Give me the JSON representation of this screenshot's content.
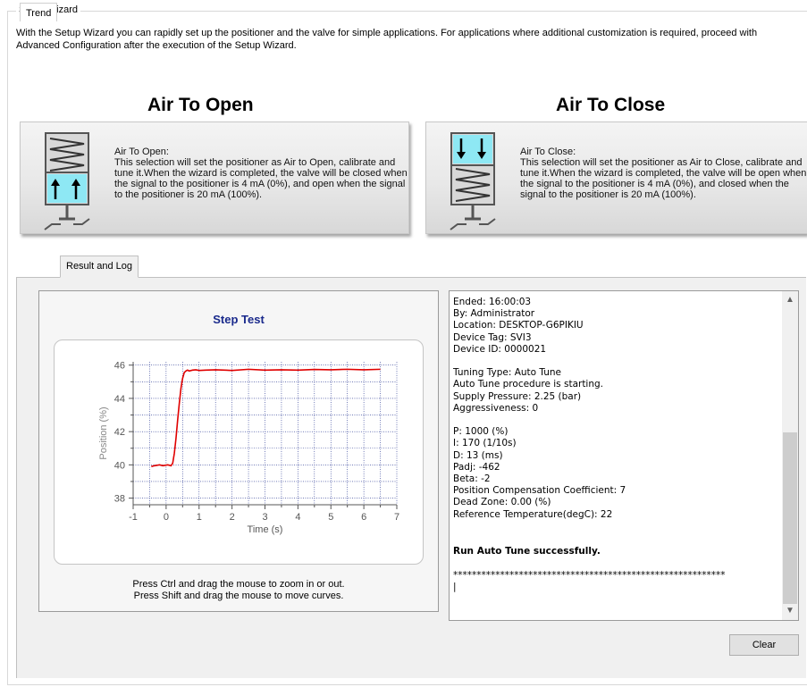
{
  "group_title": "Setup Wizard",
  "intro": "With the Setup Wizard you can rapidly set up the positioner and the valve for simple applications. For applications where additional customization is required, proceed with Advanced Configuration after the execution of the Setup Wizard.",
  "modes": {
    "open": {
      "title": "Air To Open",
      "heading": "Air To Open:",
      "text": "This selection will set the positioner as Air to Open, calibrate and tune it.When the wizard is completed, the valve will be closed when the signal to the positioner is 4 mA (0%), and open when the signal to the positioner is 20 mA (100%)."
    },
    "close": {
      "title": "Air To Close",
      "heading": "Air To Close:",
      "text": "This selection will set the positioner as Air to Close, calibrate and tune it.When the wizard is completed, the valve will be open when the signal to the positioner is 4 mA (0%), and closed when the signal to the positioner is 20 mA (100%)."
    }
  },
  "tabs": [
    "Trend",
    "Result and Log"
  ],
  "active_tab": "Result and Log",
  "chart_hint": [
    "Press Ctrl and drag the mouse to zoom in or out.",
    "Press Shift and drag the mouse to move curves."
  ],
  "chart_data": {
    "type": "line",
    "title": "Step Test",
    "xlabel": "Time (s)",
    "ylabel": "Position (%)",
    "xlim": [
      -1,
      7
    ],
    "ylim": [
      37.6,
      46.2
    ],
    "xticks": [
      -1,
      0,
      1,
      2,
      3,
      4,
      5,
      6,
      7
    ],
    "yticks": [
      38,
      40,
      42,
      44,
      46
    ],
    "grid": true,
    "line_color": "#e00000",
    "series": [
      {
        "x": [
          -0.45,
          -0.35,
          -0.2,
          -0.1,
          0.05,
          0.15,
          0.2,
          0.25,
          0.3,
          0.35,
          0.4,
          0.45,
          0.5,
          0.55,
          0.6,
          0.65,
          0.7,
          0.8,
          0.9,
          1.0,
          1.2,
          1.5,
          2.0,
          2.5,
          3.0,
          3.5,
          4.0,
          4.5,
          5.0,
          5.5,
          6.0,
          6.5
        ],
        "y": [
          39.9,
          39.95,
          40.0,
          39.95,
          40.0,
          39.95,
          40.1,
          40.7,
          41.6,
          42.7,
          43.7,
          44.6,
          45.2,
          45.55,
          45.65,
          45.7,
          45.65,
          45.7,
          45.72,
          45.68,
          45.7,
          45.72,
          45.68,
          45.75,
          45.7,
          45.72,
          45.7,
          45.74,
          45.72,
          45.75,
          45.72,
          45.75
        ]
      }
    ]
  },
  "log": {
    "lines": [
      {
        "text": "Ended: 16:00:03"
      },
      {
        "text": "By: Administrator"
      },
      {
        "text": "Location: DESKTOP-G6PIKIU"
      },
      {
        "text": "Device Tag: SVI3"
      },
      {
        "text": "Device ID: 0000021"
      },
      {
        "text": ""
      },
      {
        "text": "Tuning Type: Auto Tune"
      },
      {
        "text": "Auto Tune procedure is starting."
      },
      {
        "text": "Supply Pressure: 2.25 (bar)"
      },
      {
        "text": "Aggressiveness: 0"
      },
      {
        "text": ""
      },
      {
        "text": "P: 1000 (%)"
      },
      {
        "text": "I: 170 (1/10s)"
      },
      {
        "text": "D: 13 (ms)"
      },
      {
        "text": "Padj: -462"
      },
      {
        "text": "Beta: -2"
      },
      {
        "text": "Position Compensation Coefficient: 7"
      },
      {
        "text": "Dead Zone: 0.00 (%)"
      },
      {
        "text": "Reference Temperature(degC): 22"
      },
      {
        "text": ""
      },
      {
        "text": ""
      },
      {
        "text": "Run Auto Tune successfully.",
        "bold": true
      },
      {
        "text": ""
      },
      {
        "text": "**********************************************************"
      },
      {
        "text": "|"
      }
    ]
  },
  "clear_label": "Clear"
}
